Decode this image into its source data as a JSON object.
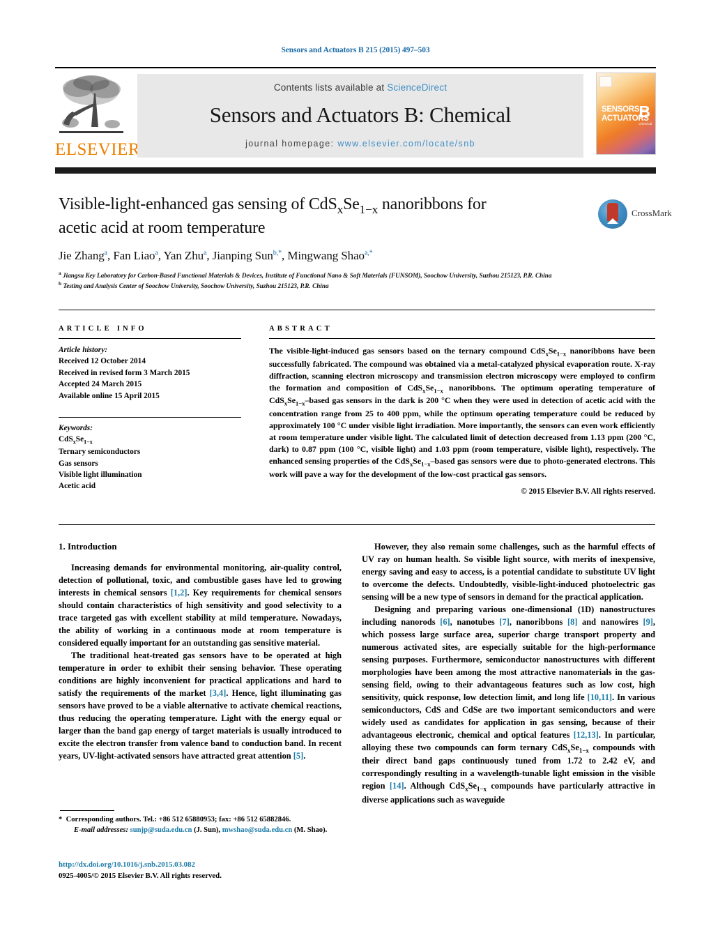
{
  "running_head": "Sensors and Actuators B 215 (2015) 497–503",
  "masthead": {
    "elsevier_wordmark": "ELSEVIER",
    "contents_prefix": "Contents lists available at ",
    "contents_link": "ScienceDirect",
    "journal_title": "Sensors and Actuators B: Chemical",
    "homepage_prefix": "journal homepage: ",
    "homepage_url": "www.elsevier.com/locate/snb",
    "cover": {
      "line1": "SENSORS",
      "and": "and",
      "line2": "ACTUATORS",
      "letter": "B",
      "sub": "Chemical"
    }
  },
  "article": {
    "title_line1_a": "Visible-light-enhanced gas sensing of CdS",
    "title_line1_sub1": "x",
    "title_line1_b": "Se",
    "title_line1_sub2": "1−x",
    "title_line1_c": " nanoribbons for",
    "title_line2": "acetic acid at room temperature",
    "authors": [
      {
        "name": "Jie Zhang",
        "marks": "a"
      },
      {
        "name": "Fan Liao",
        "marks": "a"
      },
      {
        "name": "Yan Zhu",
        "marks": "a"
      },
      {
        "name": "Jianping Sun",
        "marks": "b,*"
      },
      {
        "name": "Mingwang Shao",
        "marks": "a,*"
      }
    ],
    "affiliations": [
      {
        "mark": "a",
        "text": "Jiangsu Key Laboratory for Carbon-Based Functional Materials & Devices, Institute of Functional Nano & Soft Materials (FUNSOM), Soochow University, Suzhou 215123, P.R. China"
      },
      {
        "mark": "b",
        "text": "Testing and Analysis Center of Soochow University, Soochow University, Suzhou 215123, P.R. China"
      }
    ],
    "crossmark_label": "CrossMark"
  },
  "article_info": {
    "heading": "ARTICLE INFO",
    "history_label": "Article history:",
    "history": [
      "Received 12 October 2014",
      "Received in revised form 3 March 2015",
      "Accepted 24 March 2015",
      "Available online 15 April 2015"
    ],
    "keywords_label": "Keywords:",
    "keywords": [
      "CdSxSe1−x",
      "Ternary semiconductors",
      "Gas sensors",
      "Visible light illumination",
      "Acetic acid"
    ]
  },
  "abstract": {
    "heading": "ABSTRACT",
    "text": "The visible-light-induced gas sensors based on the ternary compound CdSxSe1−x nanoribbons have been successfully fabricated. The compound was obtained via a metal-catalyzed physical evaporation route. X-ray diffraction, scanning electron microscopy and transmission electron microscopy were employed to confirm the formation and composition of CdSxSe1−x nanoribbons. The optimum operating temperature of CdSxSe1−x–based gas sensors in the dark is 200 °C when they were used in detection of acetic acid with the concentration range from 25 to 400 ppm, while the optimum operating temperature could be reduced by approximately 100 °C under visible light irradiation. More importantly, the sensors can even work efficiently at room temperature under visible light. The calculated limit of detection decreased from 1.13 ppm (200 °C, dark) to 0.87 ppm (100 °C, visible light) and 1.03 ppm (room temperature, visible light), respectively. The enhanced sensing properties of the CdSxSe1−x–based gas sensors were due to photo-generated electrons. This work will pave a way for the development of the low-cost practical gas sensors.",
    "copyright": "© 2015 Elsevier B.V. All rights reserved."
  },
  "body": {
    "section_number_title": "1. Introduction",
    "left_paragraphs": [
      "Increasing demands for environmental monitoring, air-quality control, detection of pollutional, toxic, and combustible gases have led to growing interests in chemical sensors [1,2]. Key requirements for chemical sensors should contain characteristics of high sensitivity and good selectivity to a trace targeted gas with excellent stability at mild temperature. Nowadays, the ability of working in a continuous mode at room temperature is considered equally important for an outstanding gas sensitive material.",
      "The traditional heat-treated gas sensors have to be operated at high temperature in order to exhibit their sensing behavior. These operating conditions are highly inconvenient for practical applications and hard to satisfy the requirements of the market [3,4]. Hence, light illuminating gas sensors have proved to be a viable alternative to activate chemical reactions, thus reducing the operating temperature. Light with the energy equal or larger than the band gap energy of target materials is usually introduced to excite the electron transfer from valence band to conduction band. In recent years, UV-light-activated sensors have attracted great attention [5]."
    ],
    "right_paragraphs": [
      "However, they also remain some challenges, such as the harmful effects of UV ray on human health. So visible light source, with merits of inexpensive, energy saving and easy to access, is a potential candidate to substitute UV light to overcome the defects. Undoubtedly, visible-light-induced photoelectric gas sensing will be a new type of sensors in demand for the practical application.",
      "Designing and preparing various one-dimensional (1D) nanostructures including nanorods [6], nanotubes [7], nanoribbons [8] and nanowires [9], which possess large surface area, superior charge transport property and numerous activated sites, are especially suitable for the high-performance sensing purposes. Furthermore, semiconductor nanostructures with different morphologies have been among the most attractive nanomaterials in the gas-sensing field, owing to their advantageous features such as low cost, high sensitivity, quick response, low detection limit, and long life [10,11]. In various semiconductors, CdS and CdSe are two important semiconductors and were widely used as candidates for application in gas sensing, because of their advantageous electronic, chemical and optical features [12,13]. In particular, alloying these two compounds can form ternary CdSxSe1−x compounds with their direct band gaps continuously tuned from 1.72 to 2.42 eV, and correspondingly resulting in a wavelength-tunable light emission in the visible region [14]. Although CdSxSe1−x compounds have particularly attractive in diverse applications such as waveguide"
    ]
  },
  "footer": {
    "corresponding_marker": "*",
    "corresponding_text": "Corresponding authors. Tel.: +86 512 65880953; fax: +86 512 65882846.",
    "email_label": "E-mail addresses:",
    "email1": "sunjp@suda.edu.cn",
    "email1_who": "(J. Sun),",
    "email2": "mwshao@suda.edu.cn",
    "email2_who": "(M. Shao).",
    "doi": "http://dx.doi.org/10.1016/j.snb.2015.03.082",
    "issn_line": "0925-4005/© 2015 Elsevier B.V. All rights reserved."
  },
  "colors": {
    "link": "#1b7ba8",
    "elsevier_orange": "#ee8000",
    "band_grey": "#e8e8e8",
    "bar_black": "#1b1b1b"
  }
}
